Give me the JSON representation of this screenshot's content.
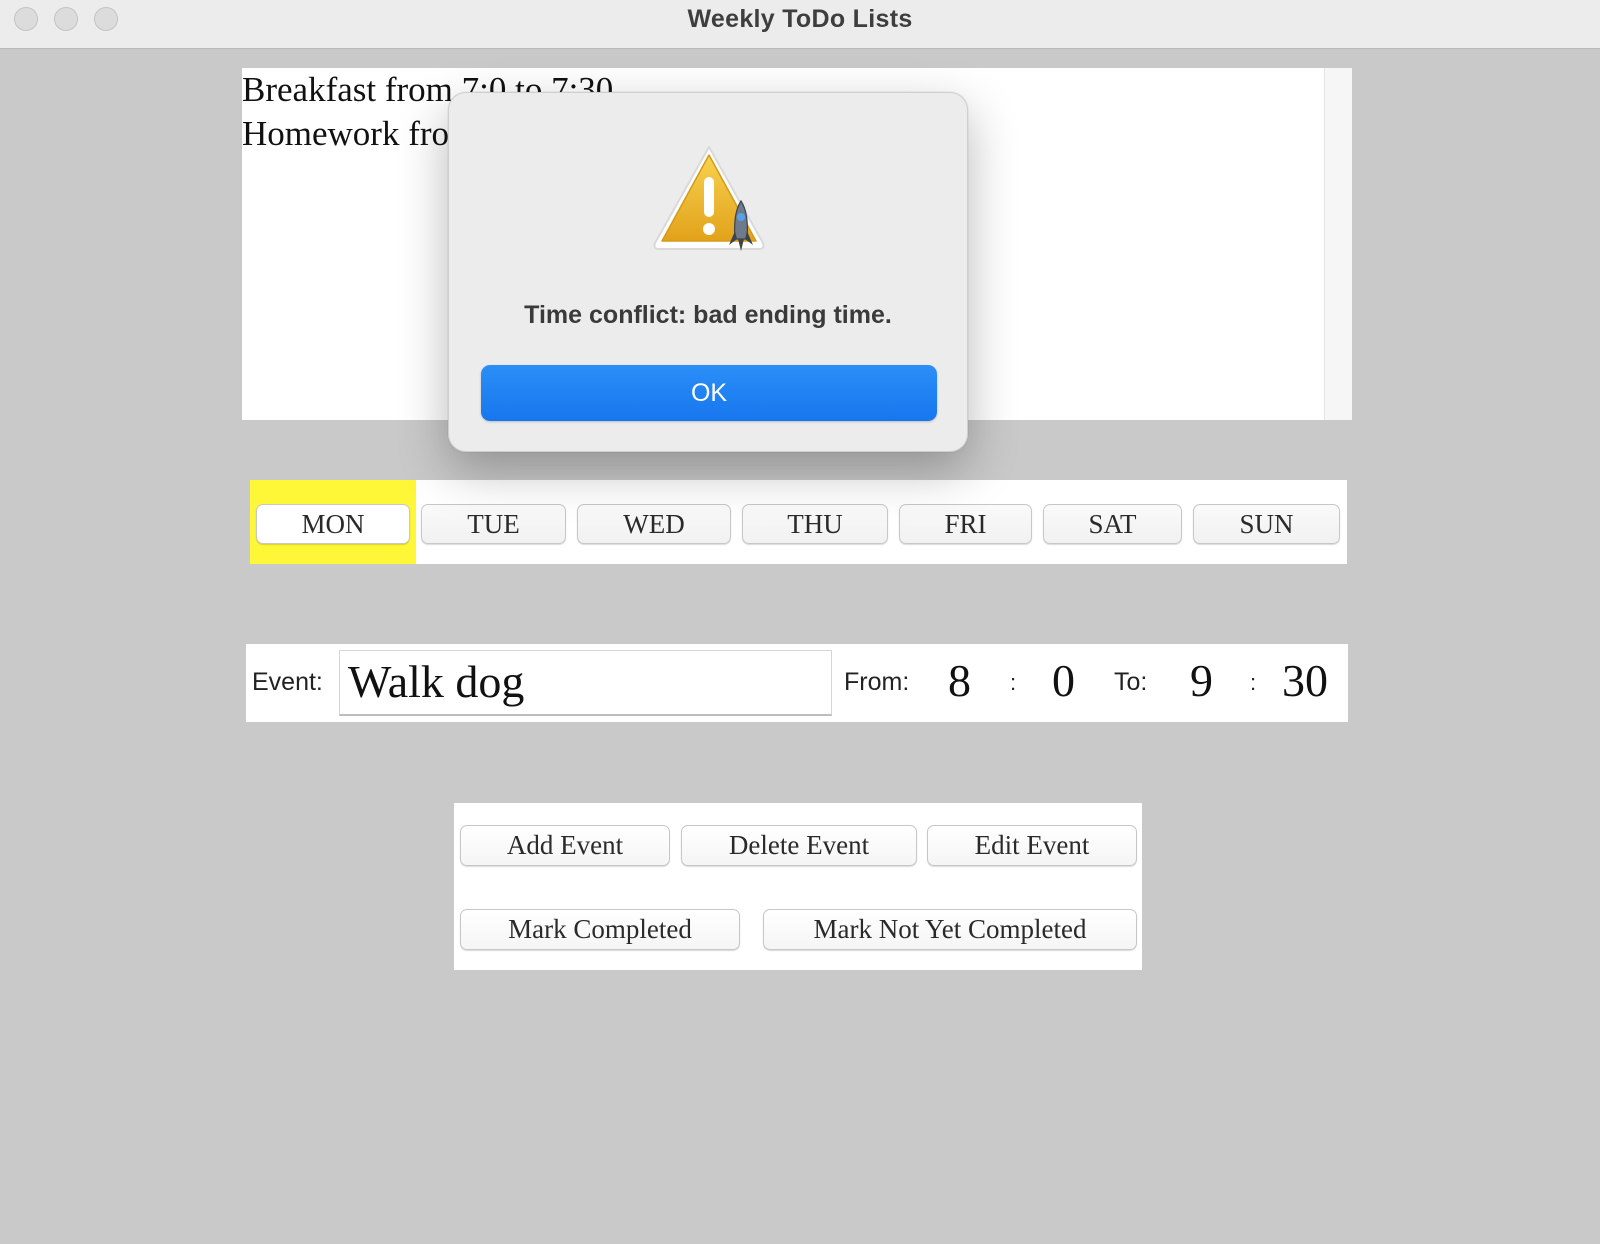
{
  "window": {
    "title": "Weekly ToDo Lists"
  },
  "event_list": {
    "lines": [
      "Breakfast from 7:0 to 7:30",
      "Homework fro"
    ]
  },
  "days": {
    "selected": "MON",
    "highlight_color": "#fdf737",
    "labels": [
      "MON",
      "TUE",
      "WED",
      "THU",
      "FRI",
      "SAT",
      "SUN"
    ]
  },
  "event_form": {
    "event_label": "Event:",
    "event_value": "Walk dog",
    "from_label": "From:",
    "from_hour": "8",
    "from_minute": "0",
    "to_label": "To:",
    "to_hour": "9",
    "to_minute": "30",
    "separator": ":"
  },
  "actions": {
    "add": "Add Event",
    "delete": "Delete Event",
    "edit": "Edit Event",
    "mark_completed": "Mark Completed",
    "mark_not_completed": "Mark Not Yet Completed"
  },
  "dialog": {
    "icon": "warning-icon",
    "message": "Time conflict: bad ending time.",
    "ok_label": "OK",
    "accent_color": "#1a7ff0"
  }
}
